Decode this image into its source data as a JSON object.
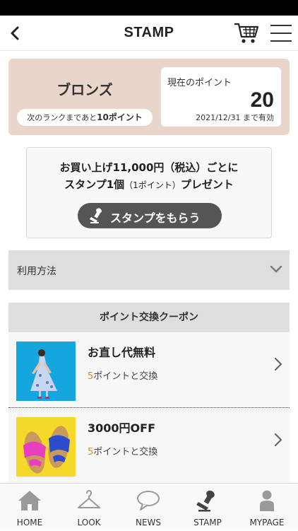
{
  "header": {
    "title": "STAMP",
    "back_icon": "chevron-left-icon",
    "cart_icon": "cart-icon",
    "menu_icon": "hamburger-menu-icon"
  },
  "rank": {
    "name": "ブロンズ",
    "next_prefix": "次のランクまであと",
    "next_points": "10ポイント",
    "points_label": "現在のポイント",
    "points_value": "20",
    "expiry": "2021/12/31 まで有効",
    "bg_color": "#ead5cb"
  },
  "stamp": {
    "line1": "お買い上げ11,000円（税込）ごとに",
    "line2_main": "スタンプ1個",
    "line2_small": "（1ポイント）",
    "line2_end": "プレゼント",
    "button_label": "スタンプをもらう",
    "button_icon": "stamp-icon"
  },
  "usage": {
    "label": "利用方法",
    "icon": "chevron-down-icon"
  },
  "coupons": {
    "header": "ポイント交換クーポン",
    "items": [
      {
        "title": "お直し代無料",
        "cost_num": "5",
        "cost_text": "ポイントと交換",
        "image": "model-in-blue-dress-photo"
      },
      {
        "title": "3000円OFF",
        "cost_num": "5",
        "cost_text": "ポイントと交換",
        "image": "sandals-photo"
      }
    ],
    "accent_color": "#d88a2a"
  },
  "tabs": [
    {
      "label": "HOME",
      "icon": "home-icon"
    },
    {
      "label": "LOOK",
      "icon": "hanger-icon"
    },
    {
      "label": "NEWS",
      "icon": "speech-bubble-icon"
    },
    {
      "label": "STAMP",
      "icon": "stamp-icon"
    },
    {
      "label": "MYPAGE",
      "icon": "person-icon"
    }
  ]
}
